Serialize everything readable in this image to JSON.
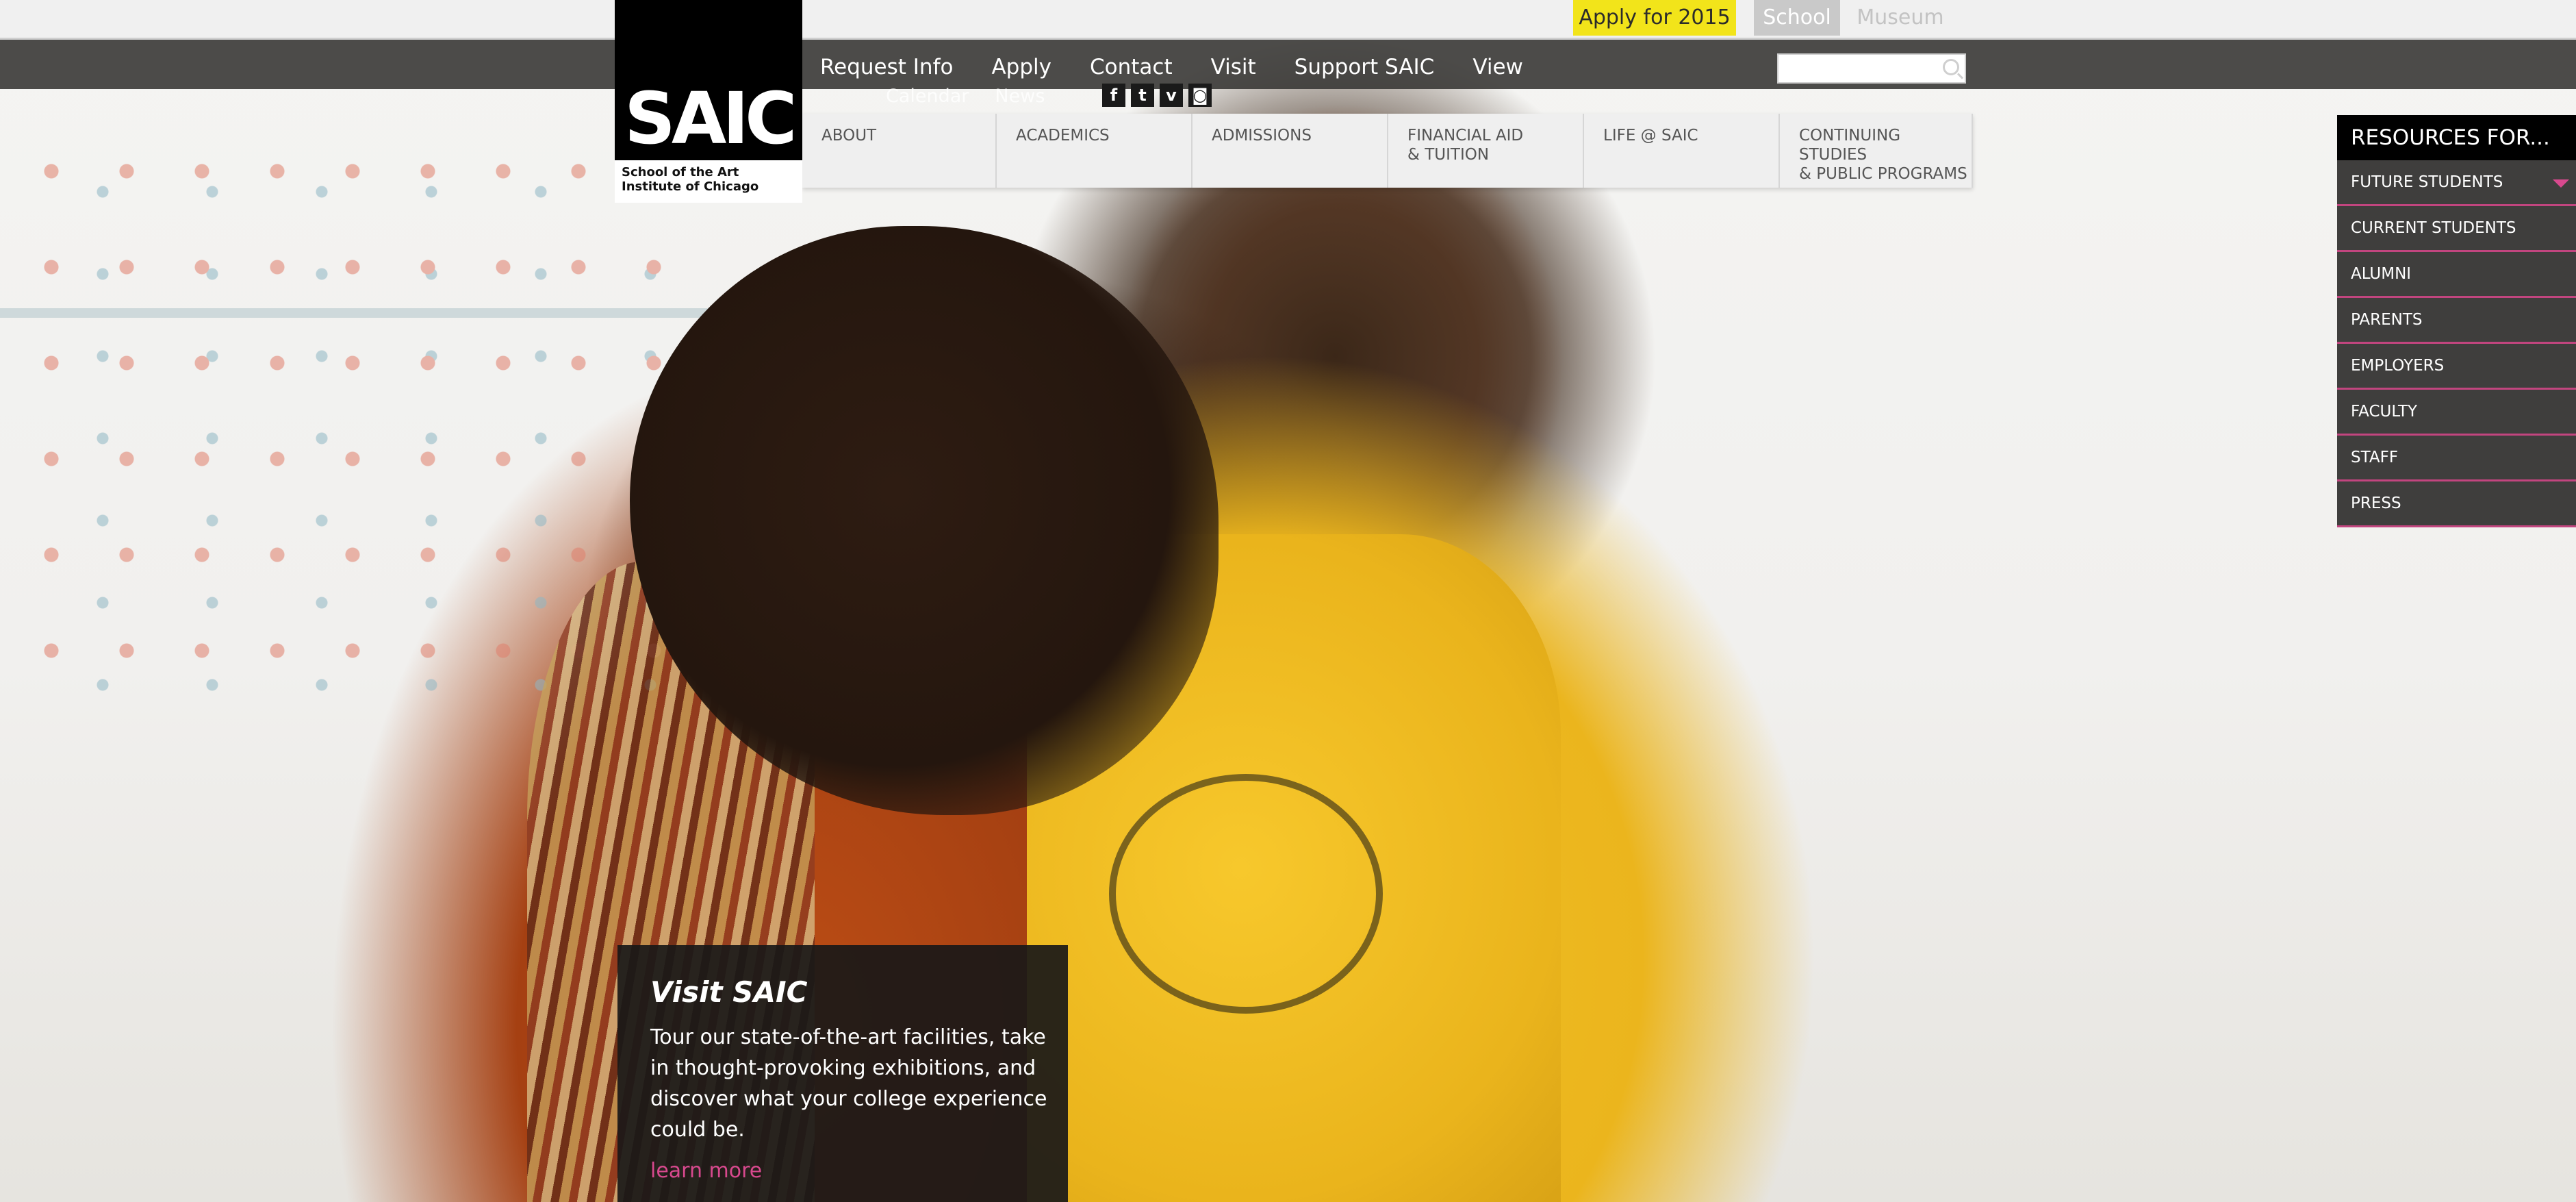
{
  "utility_bar": {
    "apply_label": "Apply for 2015",
    "school_tab": "School",
    "museum_tab": "Museum"
  },
  "logo": {
    "mark": "SAIC",
    "subtitle": "School of the Art Institute of Chicago"
  },
  "primary_nav": [
    "Request Info",
    "Apply",
    "Contact",
    "Visit",
    "Support SAIC",
    "View"
  ],
  "secondary_nav": [
    "Calendar",
    "News"
  ],
  "social": [
    {
      "icon": "facebook-icon",
      "glyph": "f"
    },
    {
      "icon": "twitter-icon",
      "glyph": "t"
    },
    {
      "icon": "vimeo-icon",
      "glyph": "v"
    },
    {
      "icon": "instagram-icon",
      "glyph": "◙"
    }
  ],
  "search": {
    "placeholder": ""
  },
  "mega_menu": [
    "ABOUT",
    "ACADEMICS",
    "ADMISSIONS",
    "FINANCIAL AID\n& TUITION",
    "LIFE @ SAIC",
    "CONTINUING STUDIES\n& PUBLIC PROGRAMS"
  ],
  "resources": {
    "title": "RESOURCES FOR...",
    "items": [
      "FUTURE STUDENTS",
      "CURRENT STUDENTS",
      "ALUMNI",
      "PARENTS",
      "EMPLOYERS",
      "FACULTY",
      "STAFF",
      "PRESS"
    ]
  },
  "feature": {
    "title": "Visit SAIC",
    "body": "Tour our state-of-the-art facilities, take in thought-provoking exhibitions, and discover what your college experience could be.",
    "link": "learn more"
  },
  "colors": {
    "apply_yellow": "#f2e41a",
    "accent_pink": "#d8498e",
    "nav_dark": "#3a3836"
  }
}
